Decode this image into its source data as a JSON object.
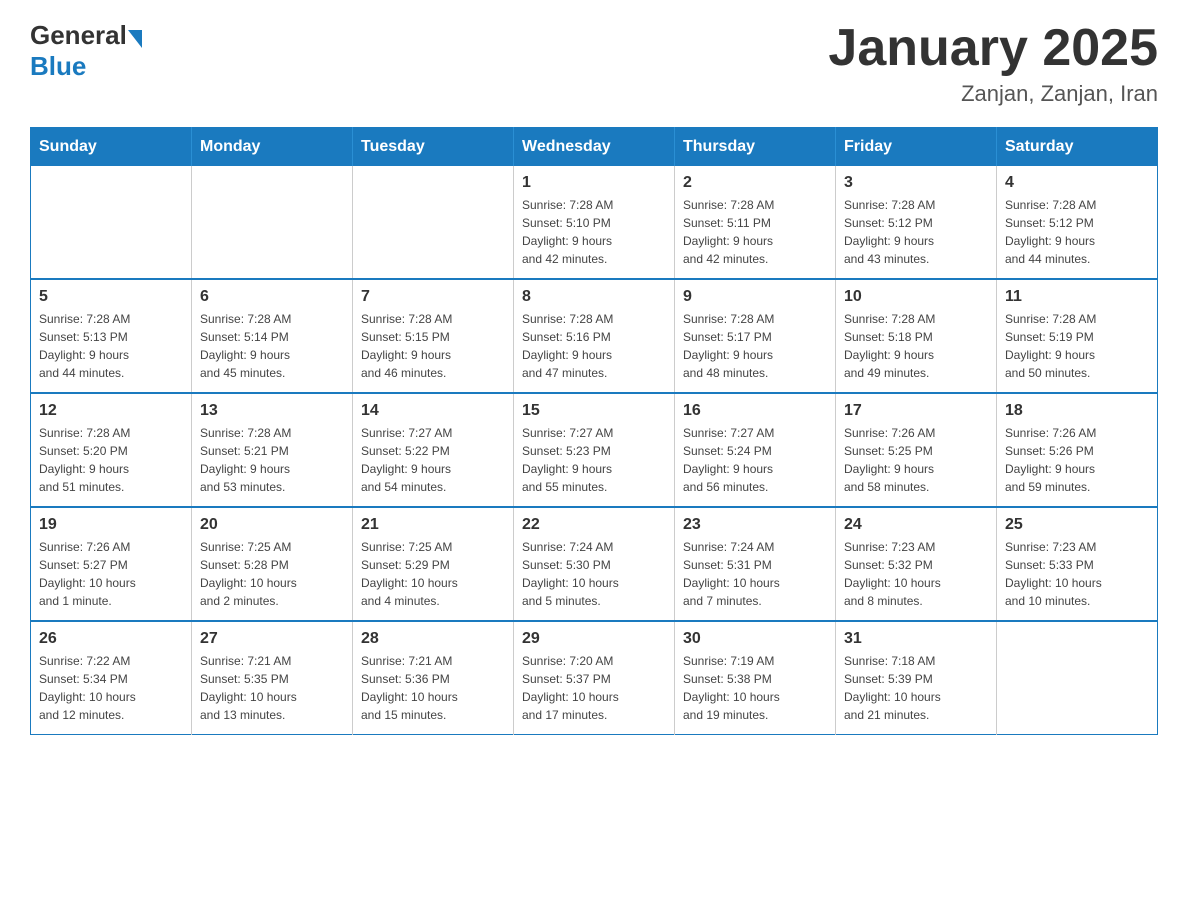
{
  "header": {
    "logo_general": "General",
    "logo_blue": "Blue",
    "month_title": "January 2025",
    "location": "Zanjan, Zanjan, Iran"
  },
  "weekdays": [
    "Sunday",
    "Monday",
    "Tuesday",
    "Wednesday",
    "Thursday",
    "Friday",
    "Saturday"
  ],
  "weeks": [
    [
      {
        "day": "",
        "info": ""
      },
      {
        "day": "",
        "info": ""
      },
      {
        "day": "",
        "info": ""
      },
      {
        "day": "1",
        "info": "Sunrise: 7:28 AM\nSunset: 5:10 PM\nDaylight: 9 hours\nand 42 minutes."
      },
      {
        "day": "2",
        "info": "Sunrise: 7:28 AM\nSunset: 5:11 PM\nDaylight: 9 hours\nand 42 minutes."
      },
      {
        "day": "3",
        "info": "Sunrise: 7:28 AM\nSunset: 5:12 PM\nDaylight: 9 hours\nand 43 minutes."
      },
      {
        "day": "4",
        "info": "Sunrise: 7:28 AM\nSunset: 5:12 PM\nDaylight: 9 hours\nand 44 minutes."
      }
    ],
    [
      {
        "day": "5",
        "info": "Sunrise: 7:28 AM\nSunset: 5:13 PM\nDaylight: 9 hours\nand 44 minutes."
      },
      {
        "day": "6",
        "info": "Sunrise: 7:28 AM\nSunset: 5:14 PM\nDaylight: 9 hours\nand 45 minutes."
      },
      {
        "day": "7",
        "info": "Sunrise: 7:28 AM\nSunset: 5:15 PM\nDaylight: 9 hours\nand 46 minutes."
      },
      {
        "day": "8",
        "info": "Sunrise: 7:28 AM\nSunset: 5:16 PM\nDaylight: 9 hours\nand 47 minutes."
      },
      {
        "day": "9",
        "info": "Sunrise: 7:28 AM\nSunset: 5:17 PM\nDaylight: 9 hours\nand 48 minutes."
      },
      {
        "day": "10",
        "info": "Sunrise: 7:28 AM\nSunset: 5:18 PM\nDaylight: 9 hours\nand 49 minutes."
      },
      {
        "day": "11",
        "info": "Sunrise: 7:28 AM\nSunset: 5:19 PM\nDaylight: 9 hours\nand 50 minutes."
      }
    ],
    [
      {
        "day": "12",
        "info": "Sunrise: 7:28 AM\nSunset: 5:20 PM\nDaylight: 9 hours\nand 51 minutes."
      },
      {
        "day": "13",
        "info": "Sunrise: 7:28 AM\nSunset: 5:21 PM\nDaylight: 9 hours\nand 53 minutes."
      },
      {
        "day": "14",
        "info": "Sunrise: 7:27 AM\nSunset: 5:22 PM\nDaylight: 9 hours\nand 54 minutes."
      },
      {
        "day": "15",
        "info": "Sunrise: 7:27 AM\nSunset: 5:23 PM\nDaylight: 9 hours\nand 55 minutes."
      },
      {
        "day": "16",
        "info": "Sunrise: 7:27 AM\nSunset: 5:24 PM\nDaylight: 9 hours\nand 56 minutes."
      },
      {
        "day": "17",
        "info": "Sunrise: 7:26 AM\nSunset: 5:25 PM\nDaylight: 9 hours\nand 58 minutes."
      },
      {
        "day": "18",
        "info": "Sunrise: 7:26 AM\nSunset: 5:26 PM\nDaylight: 9 hours\nand 59 minutes."
      }
    ],
    [
      {
        "day": "19",
        "info": "Sunrise: 7:26 AM\nSunset: 5:27 PM\nDaylight: 10 hours\nand 1 minute."
      },
      {
        "day": "20",
        "info": "Sunrise: 7:25 AM\nSunset: 5:28 PM\nDaylight: 10 hours\nand 2 minutes."
      },
      {
        "day": "21",
        "info": "Sunrise: 7:25 AM\nSunset: 5:29 PM\nDaylight: 10 hours\nand 4 minutes."
      },
      {
        "day": "22",
        "info": "Sunrise: 7:24 AM\nSunset: 5:30 PM\nDaylight: 10 hours\nand 5 minutes."
      },
      {
        "day": "23",
        "info": "Sunrise: 7:24 AM\nSunset: 5:31 PM\nDaylight: 10 hours\nand 7 minutes."
      },
      {
        "day": "24",
        "info": "Sunrise: 7:23 AM\nSunset: 5:32 PM\nDaylight: 10 hours\nand 8 minutes."
      },
      {
        "day": "25",
        "info": "Sunrise: 7:23 AM\nSunset: 5:33 PM\nDaylight: 10 hours\nand 10 minutes."
      }
    ],
    [
      {
        "day": "26",
        "info": "Sunrise: 7:22 AM\nSunset: 5:34 PM\nDaylight: 10 hours\nand 12 minutes."
      },
      {
        "day": "27",
        "info": "Sunrise: 7:21 AM\nSunset: 5:35 PM\nDaylight: 10 hours\nand 13 minutes."
      },
      {
        "day": "28",
        "info": "Sunrise: 7:21 AM\nSunset: 5:36 PM\nDaylight: 10 hours\nand 15 minutes."
      },
      {
        "day": "29",
        "info": "Sunrise: 7:20 AM\nSunset: 5:37 PM\nDaylight: 10 hours\nand 17 minutes."
      },
      {
        "day": "30",
        "info": "Sunrise: 7:19 AM\nSunset: 5:38 PM\nDaylight: 10 hours\nand 19 minutes."
      },
      {
        "day": "31",
        "info": "Sunrise: 7:18 AM\nSunset: 5:39 PM\nDaylight: 10 hours\nand 21 minutes."
      },
      {
        "day": "",
        "info": ""
      }
    ]
  ]
}
